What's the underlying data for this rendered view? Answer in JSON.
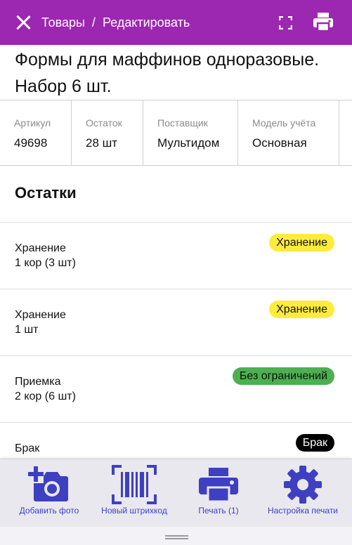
{
  "header": {
    "breadcrumb_root": "Товары",
    "breadcrumb_sep": "/",
    "breadcrumb_current": "Редактировать",
    "close_icon": "close-icon",
    "fullscreen_icon": "fullscreen-icon",
    "print_icon": "printer-icon",
    "color": "#9c27b0"
  },
  "product": {
    "title": "Формы для маффинов одноразовые. Набор 6 шт."
  },
  "info": [
    {
      "label": "Артикул",
      "value": "49698"
    },
    {
      "label": "Остаток",
      "value": "28 шт"
    },
    {
      "label": "Поставщик",
      "value": "Мультидом"
    },
    {
      "label": "Модель учёта",
      "value": "Основная"
    }
  ],
  "stock": {
    "title": "Остатки",
    "rows": [
      {
        "location": "Хранение",
        "quantity": "1 кор (3 шт)",
        "badge": "Хранение",
        "badge_color": "#ffeb3b",
        "badge_text_color": "#111111"
      },
      {
        "location": "Хранение",
        "quantity": "1 шт",
        "badge": "Хранение",
        "badge_color": "#ffeb3b",
        "badge_text_color": "#111111"
      },
      {
        "location": "Приемка",
        "quantity": "2 кор (6 шт)",
        "badge": "Без ограничений",
        "badge_color": "#4caf50",
        "badge_text_color": "#111111"
      },
      {
        "location": "Брак",
        "quantity": "",
        "badge": "Брак",
        "badge_color": "#000000",
        "badge_text_color": "#ffffff"
      }
    ]
  },
  "actions": [
    {
      "label": "Добавить фото",
      "icon": "add-photo-icon"
    },
    {
      "label": "Новый штрихкод",
      "icon": "barcode-scan-icon"
    },
    {
      "label": "Печать (1)",
      "icon": "printer-icon"
    },
    {
      "label": "Настройка печати",
      "icon": "gear-icon"
    }
  ],
  "accent_color": "#3f3fc2"
}
